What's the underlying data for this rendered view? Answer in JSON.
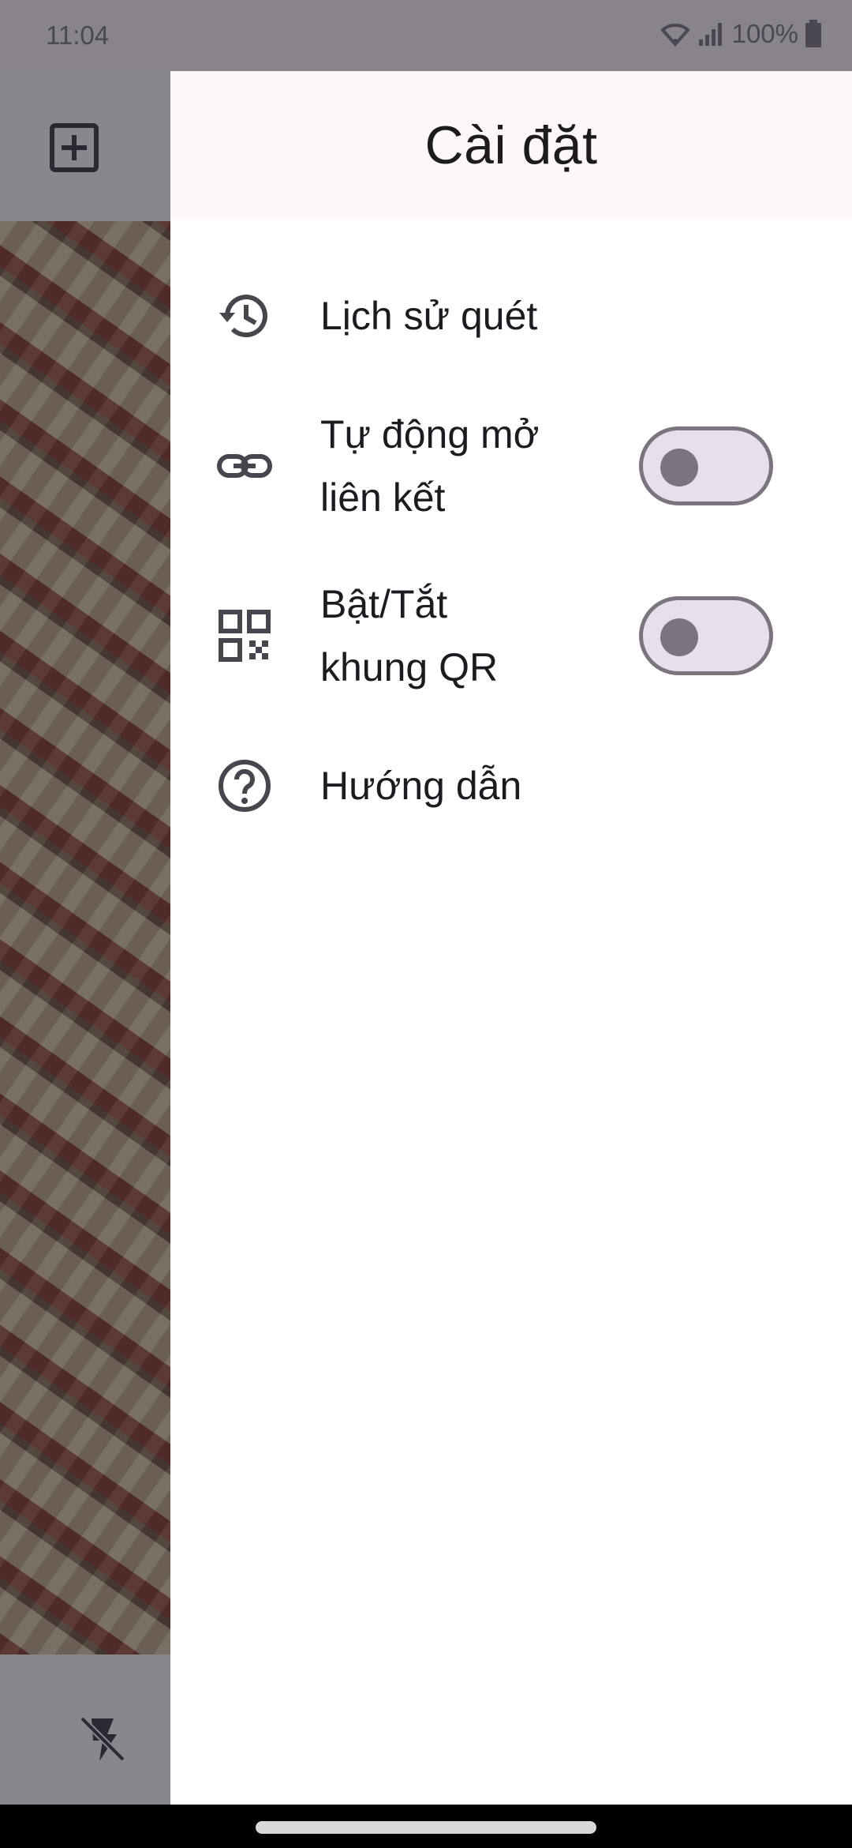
{
  "status_bar": {
    "time": "11:04",
    "battery": "100%",
    "icons": [
      "wifi-icon",
      "signal-icon",
      "battery-icon"
    ]
  },
  "background_app": {
    "toolbar_icon": "add-box-icon",
    "bottom_icon": "flash-off-icon"
  },
  "drawer": {
    "title": "Cài đặt",
    "items": [
      {
        "icon": "history-icon",
        "label": "Lịch sử quét",
        "has_switch": false
      },
      {
        "icon": "link-icon",
        "label_line1": "Tự động mở",
        "label_line2": "liên kết",
        "has_switch": true,
        "switch_on": false
      },
      {
        "icon": "qr-code-icon",
        "label_line1": "Bật/Tắt",
        "label_line2": "khung QR",
        "has_switch": true,
        "switch_on": false
      },
      {
        "icon": "help-icon",
        "label": "Hướng dẫn",
        "has_switch": false
      }
    ]
  },
  "colors": {
    "drawer_header_bg": "#fdf6fb",
    "text": "#1d1b20",
    "icon": "#49454f",
    "switch_track": "#e7e0ec",
    "switch_outline": "#79747e",
    "scrim": "#8a878c"
  }
}
